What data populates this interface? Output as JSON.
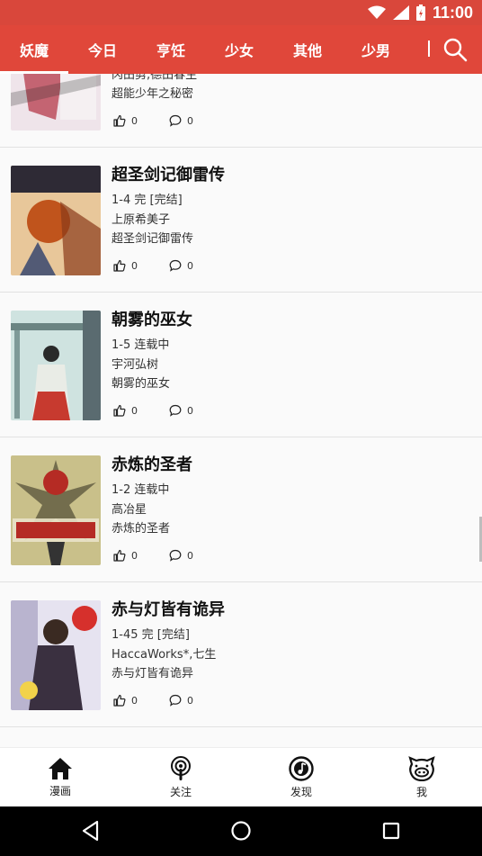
{
  "status": {
    "time": "11:00"
  },
  "tabs": [
    "妖魔",
    "今日",
    "亨饪",
    "少女",
    "其他",
    "少男"
  ],
  "items": [
    {
      "title": "",
      "chapters": "",
      "author": "冈田剪,德田春生",
      "desc": "超能少年之秘密",
      "likes": "0",
      "comments": "0",
      "cover_colors": [
        "#efe4ea",
        "#b53a4a",
        "#f5f0f2"
      ]
    },
    {
      "title": "超圣剑记御雷传",
      "chapters": "1-4 完 [完结]",
      "author": "上原希美子",
      "desc": "超圣剑记御雷传",
      "likes": "0",
      "comments": "0",
      "cover_colors": [
        "#e8c79a",
        "#c0541c",
        "#2e2a35"
      ]
    },
    {
      "title": "朝雾的巫女",
      "chapters": "1-5 连载中",
      "author": "宇河弘树",
      "desc": "朝雾的巫女",
      "likes": "0",
      "comments": "0",
      "cover_colors": [
        "#cfe3e0",
        "#c73a2f",
        "#e9ece6"
      ]
    },
    {
      "title": "赤炼的圣者",
      "chapters": "1-2 连载中",
      "author": "高冶星",
      "desc": "赤炼的圣者",
      "likes": "0",
      "comments": "0",
      "cover_colors": [
        "#c9c08a",
        "#b52b24",
        "#3a3624"
      ]
    },
    {
      "title": "赤与灯皆有诡异",
      "chapters": "1-45 完 [完结]",
      "author": "HaccaWorks*,七生",
      "desc": "赤与灯皆有诡异",
      "likes": "0",
      "comments": "0",
      "cover_colors": [
        "#f2d24a",
        "#d6302c",
        "#3a3040"
      ]
    }
  ],
  "bottom_nav": [
    {
      "label": "漫画",
      "icon": "home-icon"
    },
    {
      "label": "关注",
      "icon": "podcast-icon"
    },
    {
      "label": "发现",
      "icon": "music-disc-icon"
    },
    {
      "label": "我",
      "icon": "pig-face-icon"
    }
  ]
}
